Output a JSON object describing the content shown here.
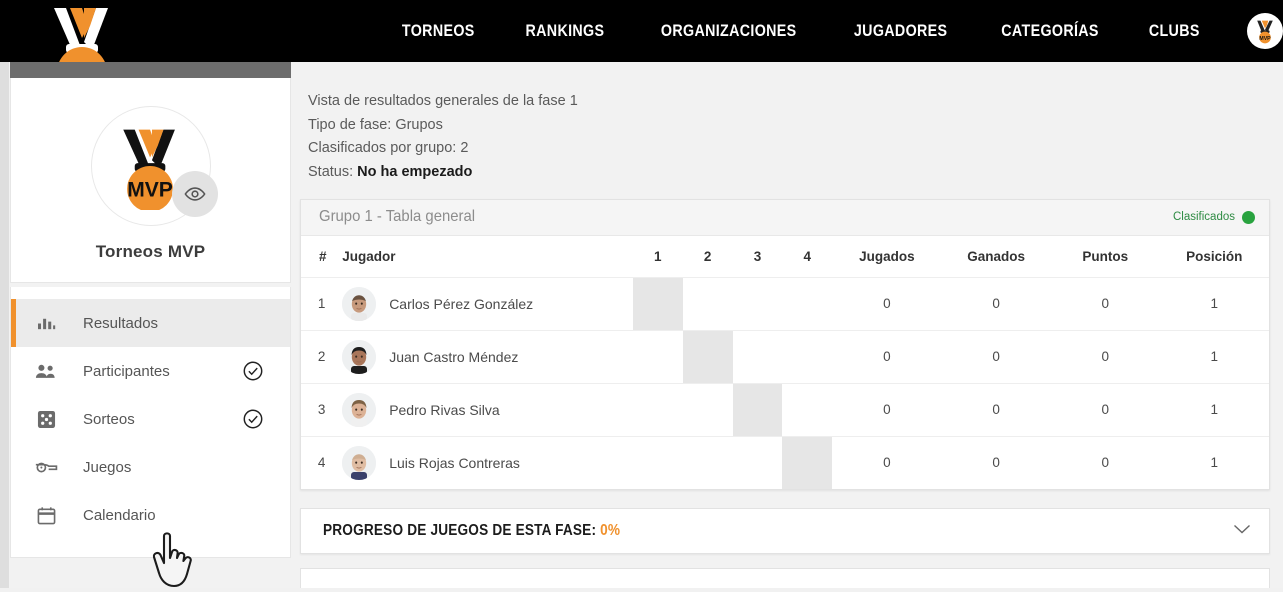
{
  "nav": {
    "brand_icon": "mvp-medal-logo",
    "links": [
      {
        "label": "TORNEOS"
      },
      {
        "label": "RANKINGS"
      },
      {
        "label": "ORGANIZACIONES"
      },
      {
        "label": "JUGADORES"
      },
      {
        "label": "CATEGORÍAS"
      },
      {
        "label": "CLUBS"
      }
    ],
    "avatar_icon": "user-avatar-medal"
  },
  "sidebar": {
    "profile": {
      "name": "Torneos MVP",
      "logo_icon": "mvp-medal-logo",
      "eye_icon": "eye-icon"
    },
    "menu": [
      {
        "label": "Resultados",
        "icon": "bar-chart-icon",
        "active": true,
        "check": false
      },
      {
        "label": "Participantes",
        "icon": "people-icon",
        "active": false,
        "check": true
      },
      {
        "label": "Sorteos",
        "icon": "dice-icon",
        "active": false,
        "check": true
      },
      {
        "label": "Juegos",
        "icon": "whistle-icon",
        "active": false,
        "check": false
      },
      {
        "label": "Calendario",
        "icon": "calendar-icon",
        "active": false,
        "check": false
      }
    ]
  },
  "main": {
    "info": {
      "line1": "Vista de resultados generales de la fase 1",
      "line2": "Tipo de fase: Grupos",
      "line3": "Clasificados por grupo: 2",
      "status_label": "Status: ",
      "status_value": "No ha empezado"
    },
    "table": {
      "title": "Grupo 1 - Tabla general",
      "badge_label": "Clasificados",
      "badge_color": "#29a33f",
      "columns": [
        "#",
        "Jugador",
        "1",
        "2",
        "3",
        "4",
        "Jugados",
        "Ganados",
        "Puntos",
        "Posición"
      ],
      "rows": [
        {
          "num": "1",
          "player": "Carlos Pérez González",
          "cells": [
            "",
            "",
            "",
            ""
          ],
          "diag": 0,
          "jugados": "0",
          "ganados": "0",
          "puntos": "0",
          "posicion": "1"
        },
        {
          "num": "2",
          "player": "Juan Castro Méndez",
          "cells": [
            "",
            "",
            "",
            ""
          ],
          "diag": 1,
          "jugados": "0",
          "ganados": "0",
          "puntos": "0",
          "posicion": "1"
        },
        {
          "num": "3",
          "player": "Pedro Rivas Silva",
          "cells": [
            "",
            "",
            "",
            ""
          ],
          "diag": 2,
          "jugados": "0",
          "ganados": "0",
          "puntos": "0",
          "posicion": "1"
        },
        {
          "num": "4",
          "player": "Luis Rojas Contreras",
          "cells": [
            "",
            "",
            "",
            ""
          ],
          "diag": 3,
          "jugados": "0",
          "ganados": "0",
          "puntos": "0",
          "posicion": "1"
        }
      ]
    },
    "progress": {
      "label": "PROGRESO DE JUEGOS DE ESTA FASE: ",
      "percent": "0%",
      "accent_color": "#f0912d",
      "chevron_icon": "chevron-down-icon"
    }
  },
  "cursor": {
    "icon": "pointer-hand-cursor"
  }
}
